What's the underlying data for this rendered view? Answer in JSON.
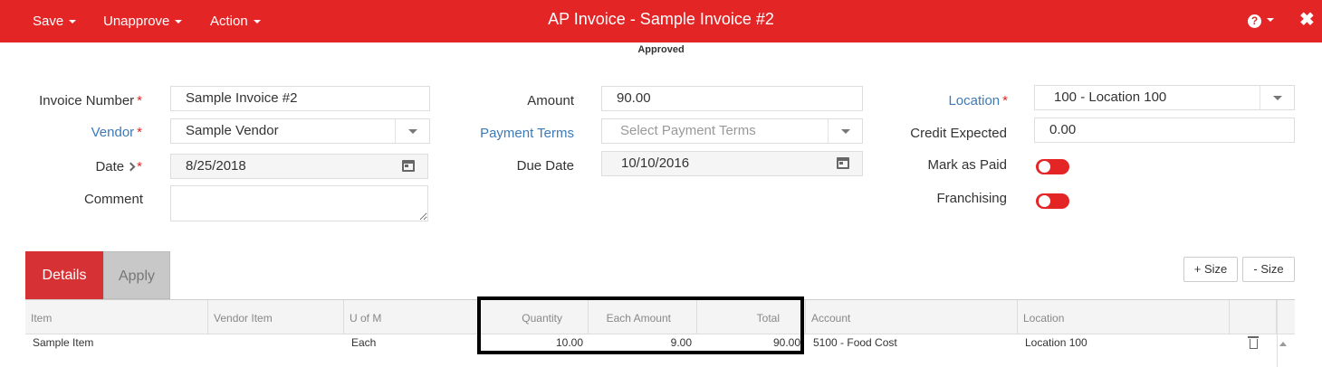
{
  "topbar": {
    "save": "Save",
    "unapprove": "Unapprove",
    "action": "Action",
    "title": "AP Invoice - Sample Invoice #2",
    "help": "?",
    "close": "✖"
  },
  "status": "Approved",
  "form": {
    "invoice_number": {
      "label": "Invoice Number",
      "value": "Sample Invoice #2"
    },
    "vendor": {
      "label": "Vendor",
      "value": "Sample Vendor"
    },
    "date": {
      "label": "Date",
      "value": "8/25/2018"
    },
    "comment": {
      "label": "Comment",
      "value": ""
    },
    "amount": {
      "label": "Amount",
      "value": "90.00"
    },
    "payment_terms": {
      "label": "Payment Terms",
      "placeholder": "Select Payment Terms"
    },
    "due_date": {
      "label": "Due Date",
      "value": "10/10/2016"
    },
    "location": {
      "label": "Location",
      "value": "100 - Location 100"
    },
    "credit_expected": {
      "label": "Credit Expected",
      "value": "0.00"
    },
    "mark_as_paid": {
      "label": "Mark as Paid",
      "on": false
    },
    "franchising": {
      "label": "Franchising",
      "on": false
    },
    "required_mark": "*"
  },
  "tabs": [
    {
      "label": "Details",
      "active": true
    },
    {
      "label": "Apply",
      "active": false
    }
  ],
  "size_buttons": {
    "plus": "+ Size",
    "minus": "- Size"
  },
  "grid": {
    "columns": [
      "Item",
      "Vendor Item",
      "U of M",
      "Quantity",
      "Each Amount",
      "Total",
      "Account",
      "Location"
    ],
    "rows": [
      {
        "item": "Sample Item",
        "vendor_item": "",
        "uom": "Each",
        "quantity": "10.00",
        "each_amount": "9.00",
        "total": "90.00",
        "account": "5100 - Food Cost",
        "location": "Location 100"
      }
    ]
  },
  "colors": {
    "brand": "#e42526",
    "link": "#3c7ab8",
    "tab_active": "#d63235"
  }
}
